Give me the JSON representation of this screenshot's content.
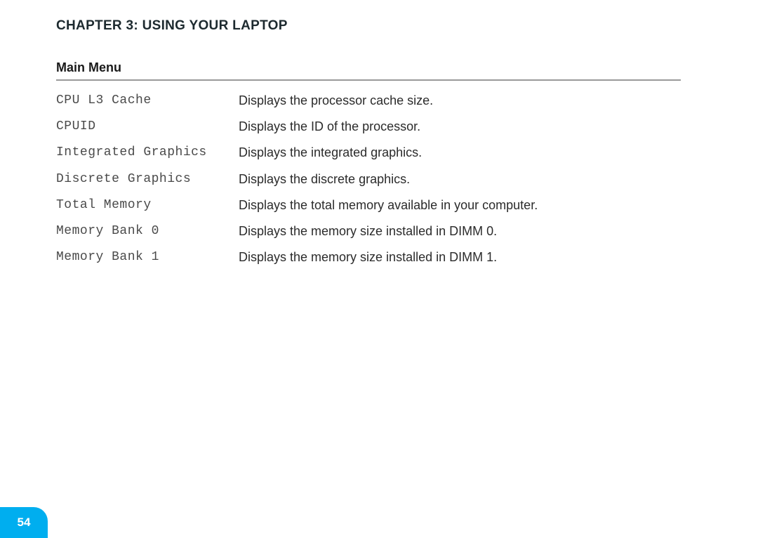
{
  "chapter_title": "CHAPTER 3: USING YOUR LAPTOP",
  "section_title": "Main Menu",
  "rows": [
    {
      "key": "CPU L3 Cache",
      "val": "Displays the processor cache size."
    },
    {
      "key": "CPUID",
      "val": "Displays the ID of the processor."
    },
    {
      "key": "Integrated Graphics",
      "val": "Displays the integrated graphics."
    },
    {
      "key": "Discrete Graphics",
      "val": "Displays the discrete graphics."
    },
    {
      "key": "Total Memory",
      "val": "Displays the total memory available in your computer."
    },
    {
      "key": "Memory Bank 0",
      "val": "Displays the memory size installed in DIMM 0."
    },
    {
      "key": "Memory Bank 1",
      "val": "Displays the memory size installed in DIMM 1."
    }
  ],
  "page_number": "54",
  "colors": {
    "tab_bg": "#00aeef"
  }
}
